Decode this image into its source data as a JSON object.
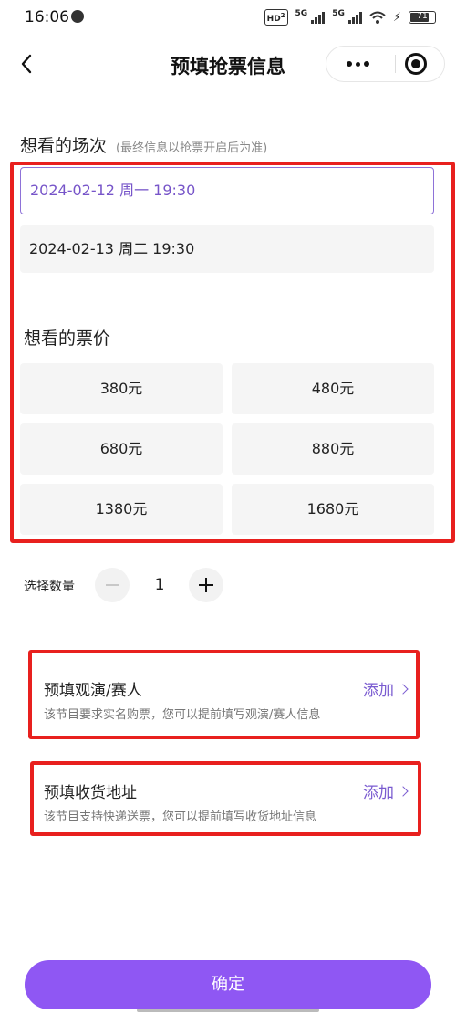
{
  "status_bar": {
    "time": "16:06",
    "hd_badge": "HD",
    "hd_sub": "2",
    "net1": "5G",
    "net2": "5G",
    "battery": "71"
  },
  "nav": {
    "back_icon": "chevron-left-icon",
    "title": "预填抢票信息",
    "more_icon": "more-dots-icon",
    "close_icon": "target-circle-icon"
  },
  "sessions": {
    "title": "想看的场次",
    "hint": "(最终信息以抢票开启后为准)",
    "items": [
      {
        "label": "2024-02-12 周一 19:30",
        "selected": true
      },
      {
        "label": "2024-02-13 周二 19:30",
        "selected": false
      }
    ]
  },
  "prices": {
    "title": "想看的票价",
    "items": [
      "380元",
      "480元",
      "680元",
      "880元",
      "1380元",
      "1680元"
    ]
  },
  "quantity": {
    "label": "选择数量",
    "value": "1"
  },
  "prefill": {
    "attendee": {
      "title": "预填观演/赛人",
      "desc": "该节目要求实名购票，您可以提前填写观演/赛人信息",
      "action": "添加"
    },
    "address": {
      "title": "预填收货地址",
      "desc": "该节目支持快递送票，您可以提前填写收货地址信息",
      "action": "添加"
    }
  },
  "confirm_label": "确定",
  "colors": {
    "accent": "#8f57f3",
    "selected_text": "#7755c9",
    "highlight_frame": "#e8201e"
  }
}
